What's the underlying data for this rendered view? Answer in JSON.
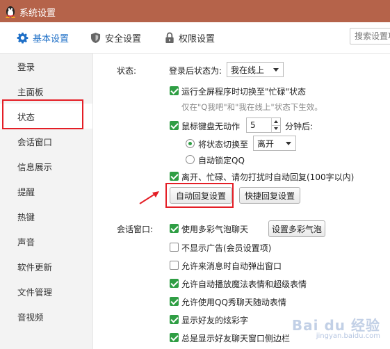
{
  "window": {
    "title": "系统设置"
  },
  "tabs": [
    {
      "label": "基本设置",
      "icon": "gear-icon",
      "active": true
    },
    {
      "label": "安全设置",
      "icon": "shield-icon"
    },
    {
      "label": "权限设置",
      "icon": "lock-icon"
    }
  ],
  "search": {
    "placeholder": "搜索设置项"
  },
  "sidebar": {
    "items": [
      {
        "label": "登录"
      },
      {
        "label": "主面板"
      },
      {
        "label": "状态",
        "active": true
      },
      {
        "label": "会话窗口"
      },
      {
        "label": "信息展示"
      },
      {
        "label": "提醒"
      },
      {
        "label": "热键"
      },
      {
        "label": "声音"
      },
      {
        "label": "软件更新"
      },
      {
        "label": "文件管理"
      },
      {
        "label": "音视频"
      }
    ]
  },
  "status": {
    "section_label": "状态:",
    "login_status_label": "登录后状态为:",
    "login_status_value": "我在线上",
    "fullscreen_busy_label": "运行全屏程序时切换至\"忙碌\"状态",
    "fullscreen_busy_checked": true,
    "fullscreen_note": "仅在\"Q我吧\"和\"我在线上\"状态下生效。",
    "idle_label": "鼠标键盘无动作",
    "idle_checked": true,
    "idle_minutes": "5",
    "minutes_suffix": "分钟后:",
    "switch_status_label": "将状态切换至",
    "switch_status_selected": true,
    "switch_status_value": "离开",
    "auto_lock_label": "自动锁定QQ",
    "auto_lock_selected": false,
    "auto_reply_label": "离开、忙碌、请勿打扰时自动回复(100字以内)",
    "auto_reply_checked": true,
    "auto_reply_settings_button": "自动回复设置",
    "quick_reply_settings_button": "快捷回复设置"
  },
  "chat_window": {
    "section_label": "会话窗口:",
    "bubble_button": "设置多彩气泡",
    "options": [
      {
        "label": "使用多彩气泡聊天",
        "checked": true
      },
      {
        "label": "不显示广告(会员设置项)",
        "checked": false
      },
      {
        "label": "允许来消息时自动弹出窗口",
        "checked": false
      },
      {
        "label": "允许自动播放魔法表情和超级表情",
        "checked": true
      },
      {
        "label": "允许使用QQ秀聊天随动表情",
        "checked": true
      },
      {
        "label": "显示好友的炫彩字",
        "checked": true
      },
      {
        "label": "总是显示好友聊天窗口侧边栏",
        "checked": true
      }
    ]
  },
  "watermark": {
    "brand": "Bai du 经验",
    "url": "jingyan.baidu.com"
  },
  "colors": {
    "titlebar": "#b5634a",
    "accent": "#1e6fc7",
    "highlight": "#e41e26",
    "check": "#2f9e44"
  }
}
